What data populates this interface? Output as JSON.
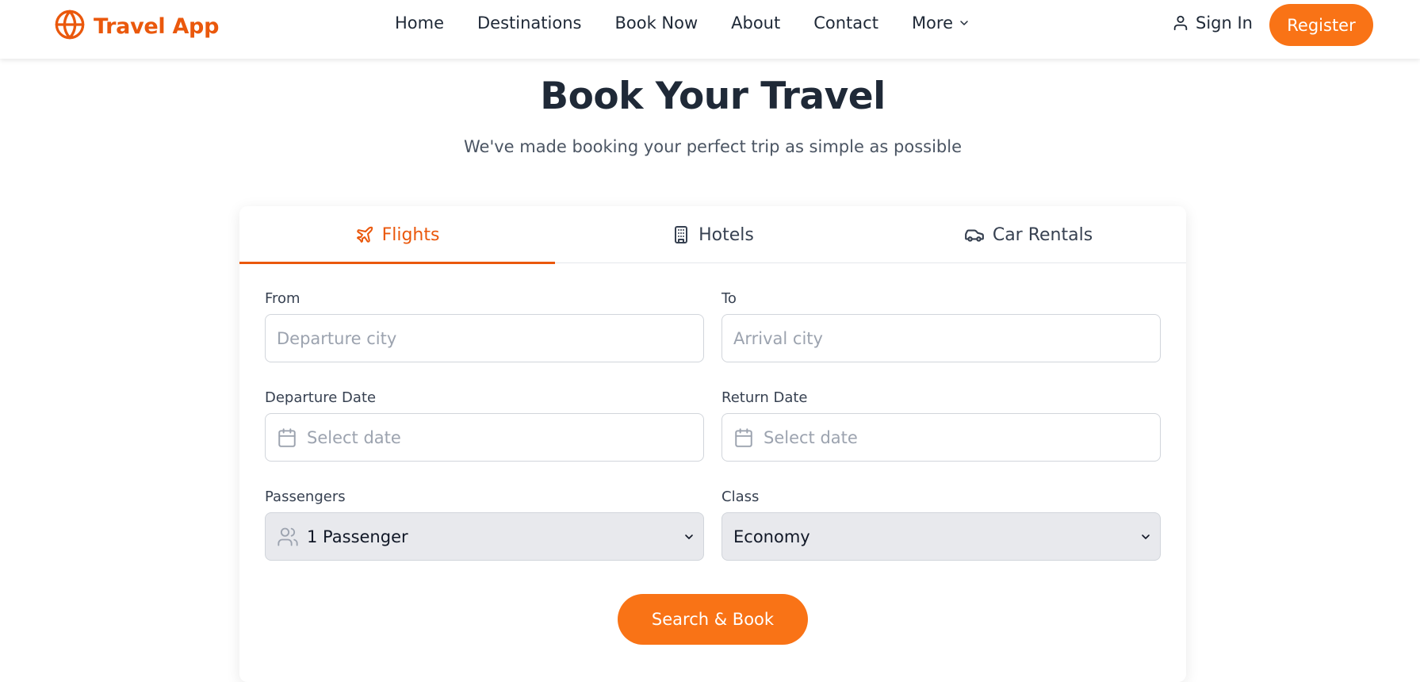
{
  "brand": {
    "name": "Travel App",
    "logo_icon": "globe-icon",
    "color": "#ea580c"
  },
  "nav": {
    "items": [
      "Home",
      "Destinations",
      "Book Now",
      "About",
      "Contact"
    ],
    "more_label": "More",
    "sign_in_label": "Sign In",
    "register_label": "Register"
  },
  "hero": {
    "title": "Book Your Travel",
    "subtitle": "We've made booking your perfect trip as simple as possible"
  },
  "tabs": [
    {
      "label": "Flights",
      "icon": "plane-icon",
      "active": true
    },
    {
      "label": "Hotels",
      "icon": "building-icon",
      "active": false
    },
    {
      "label": "Car Rentals",
      "icon": "car-icon",
      "active": false
    }
  ],
  "form": {
    "from": {
      "label": "From",
      "placeholder": "Departure city"
    },
    "to": {
      "label": "To",
      "placeholder": "Arrival city"
    },
    "departure_date": {
      "label": "Departure Date",
      "placeholder": "Select date"
    },
    "return_date": {
      "label": "Return Date",
      "placeholder": "Select date"
    },
    "passengers": {
      "label": "Passengers",
      "value": "1 Passenger"
    },
    "class": {
      "label": "Class",
      "value": "Economy"
    },
    "submit_label": "Search & Book"
  },
  "colors": {
    "accent": "#f97316",
    "accent_dark": "#ea580c",
    "text": "#1f2937",
    "muted": "#4b5563"
  }
}
